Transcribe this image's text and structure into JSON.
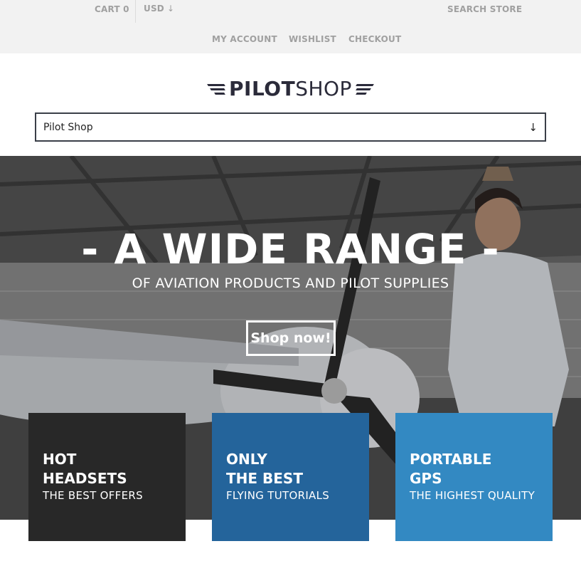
{
  "topbar": {
    "cart": "CART 0",
    "currency": "USD",
    "search": "SEARCH STORE",
    "my_account": "MY ACCOUNT",
    "wishlist": "WISHLIST",
    "checkout": "CHECKOUT"
  },
  "logo": {
    "bold": "PILOT",
    "light": "SHOP"
  },
  "nav_select": {
    "value": "Pilot Shop",
    "arrow": "↓"
  },
  "hero": {
    "title": "- A WIDE RANGE -",
    "subtitle": "OF AVIATION PRODUCTS AND PILOT SUPPLIES",
    "button": "Shop now!"
  },
  "promos": [
    {
      "line1": "HOT",
      "line2": "HEADSETS",
      "line3": "THE BEST OFFERS",
      "color": "#282828"
    },
    {
      "line1": "ONLY",
      "line2": "THE BEST",
      "line3": "FLYING TUTORIALS",
      "color": "#24649b"
    },
    {
      "line1": "PORTABLE",
      "line2": "GPS",
      "line3": "THE HIGHEST QUALITY",
      "color": "#3389c2"
    }
  ],
  "icons": {
    "currency_arrow": "↓"
  }
}
